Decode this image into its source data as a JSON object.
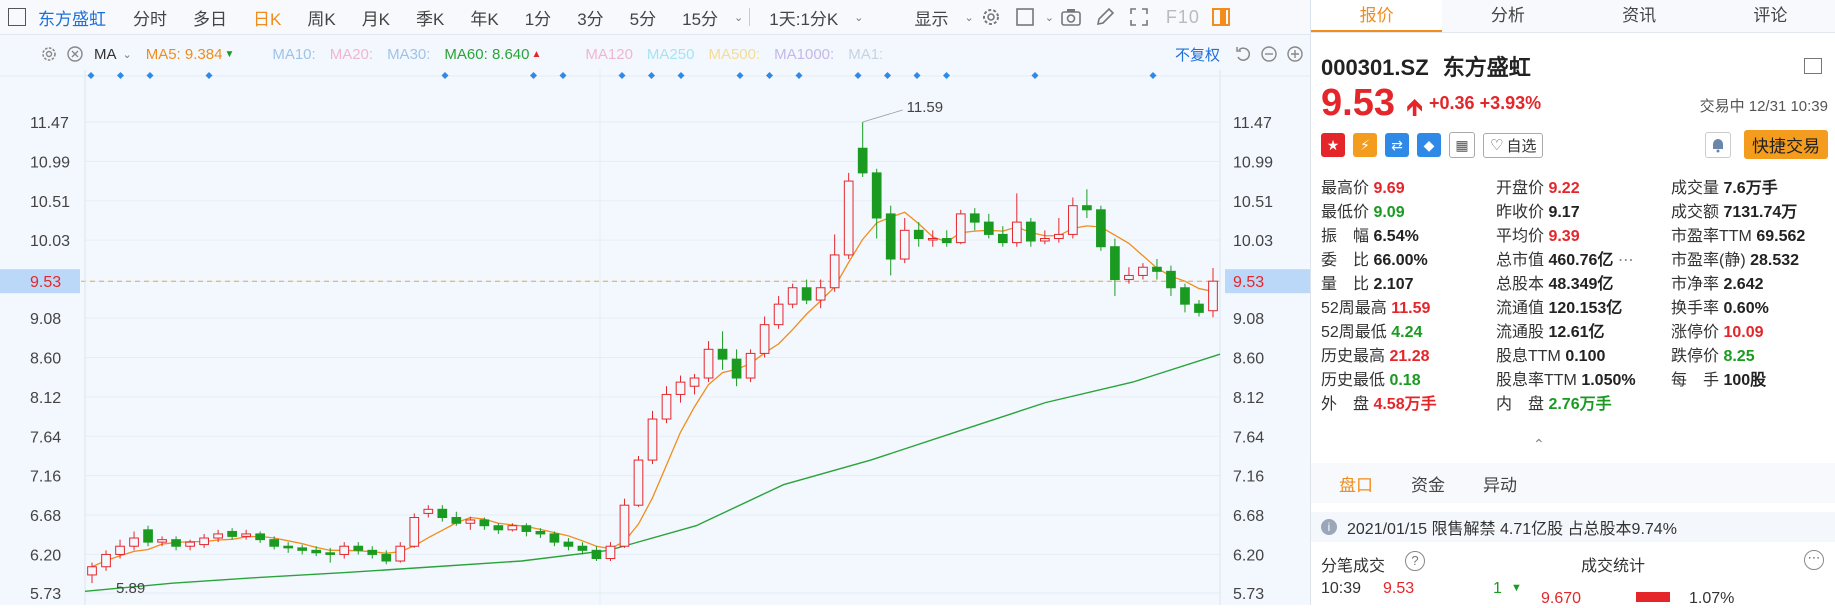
{
  "toolbar": {
    "stock_name": "东方盛虹",
    "periods": [
      "分时",
      "多日",
      "日K",
      "周K",
      "月K",
      "季K",
      "年K",
      "1分",
      "3分",
      "5分",
      "15分"
    ],
    "active_period": "日K",
    "interval_select": "1天:1分K",
    "display_label": "显示",
    "f10_label": "F10"
  },
  "ma_bar": {
    "ma_label": "MA",
    "ma5": "MA5: 9.384",
    "ma10": "MA10:",
    "ma20": "MA20:",
    "ma30": "MA30:",
    "ma60": "MA60: 8.640",
    "ma120": "MA120",
    "ma250": "MA250",
    "ma500": "MA500:",
    "ma1000": "MA1000:",
    "ma1": "MA1:",
    "adjust": "不复权"
  },
  "chart_data": {
    "type": "candlestick",
    "yticks": [
      "11.47",
      "10.99",
      "10.51",
      "10.03",
      "9.53",
      "9.08",
      "8.60",
      "8.12",
      "7.64",
      "7.16",
      "6.68",
      "6.20",
      "5.73"
    ],
    "ylim": [
      5.73,
      11.47
    ],
    "high_marker": "11.59",
    "low_marker": "5.89",
    "current_price_tag": "9.53",
    "series": [
      {
        "name": "MA5",
        "color": "#f08d1c"
      },
      {
        "name": "MA60",
        "color": "#2aa33a"
      }
    ],
    "candles": [
      [
        5.95,
        6.05,
        5.85,
        6.1
      ],
      [
        6.05,
        6.2,
        6.0,
        6.25
      ],
      [
        6.2,
        6.3,
        6.15,
        6.38
      ],
      [
        6.3,
        6.4,
        6.25,
        6.48
      ],
      [
        6.5,
        6.35,
        6.3,
        6.55
      ],
      [
        6.35,
        6.38,
        6.3,
        6.42
      ],
      [
        6.38,
        6.3,
        6.25,
        6.42
      ],
      [
        6.3,
        6.35,
        6.25,
        6.38
      ],
      [
        6.32,
        6.4,
        6.28,
        6.45
      ],
      [
        6.4,
        6.45,
        6.35,
        6.5
      ],
      [
        6.48,
        6.42,
        6.38,
        6.52
      ],
      [
        6.42,
        6.45,
        6.38,
        6.5
      ],
      [
        6.45,
        6.38,
        6.34,
        6.48
      ],
      [
        6.38,
        6.3,
        6.26,
        6.42
      ],
      [
        6.3,
        6.28,
        6.22,
        6.35
      ],
      [
        6.28,
        6.25,
        6.2,
        6.32
      ],
      [
        6.25,
        6.22,
        6.18,
        6.3
      ],
      [
        6.22,
        6.2,
        6.1,
        6.28
      ],
      [
        6.2,
        6.3,
        6.15,
        6.35
      ],
      [
        6.3,
        6.25,
        6.2,
        6.35
      ],
      [
        6.25,
        6.2,
        6.15,
        6.3
      ],
      [
        6.2,
        6.12,
        6.08,
        6.25
      ],
      [
        6.12,
        6.3,
        6.1,
        6.35
      ],
      [
        6.3,
        6.65,
        6.28,
        6.7
      ],
      [
        6.7,
        6.75,
        6.65,
        6.8
      ],
      [
        6.75,
        6.65,
        6.6,
        6.8
      ],
      [
        6.65,
        6.58,
        6.55,
        6.72
      ],
      [
        6.58,
        6.62,
        6.5,
        6.66
      ],
      [
        6.62,
        6.55,
        6.5,
        6.65
      ],
      [
        6.55,
        6.5,
        6.45,
        6.58
      ],
      [
        6.5,
        6.55,
        6.48,
        6.58
      ],
      [
        6.55,
        6.48,
        6.42,
        6.58
      ],
      [
        6.48,
        6.45,
        6.4,
        6.52
      ],
      [
        6.45,
        6.35,
        6.3,
        6.48
      ],
      [
        6.35,
        6.3,
        6.25,
        6.4
      ],
      [
        6.3,
        6.25,
        6.2,
        6.35
      ],
      [
        6.25,
        6.15,
        6.12,
        6.3
      ],
      [
        6.15,
        6.3,
        6.12,
        6.35
      ],
      [
        6.3,
        6.8,
        6.28,
        6.88
      ],
      [
        6.8,
        7.35,
        6.78,
        7.4
      ],
      [
        7.35,
        7.85,
        7.3,
        7.95
      ],
      [
        7.85,
        8.15,
        7.8,
        8.25
      ],
      [
        8.15,
        8.3,
        8.05,
        8.38
      ],
      [
        8.25,
        8.35,
        8.15,
        8.4
      ],
      [
        8.35,
        8.7,
        8.3,
        8.8
      ],
      [
        8.7,
        8.58,
        8.45,
        8.92
      ],
      [
        8.58,
        8.35,
        8.25,
        8.7
      ],
      [
        8.35,
        8.65,
        8.3,
        8.7
      ],
      [
        8.65,
        9.0,
        8.6,
        9.1
      ],
      [
        9.0,
        9.25,
        8.95,
        9.35
      ],
      [
        9.25,
        9.45,
        9.2,
        9.5
      ],
      [
        9.45,
        9.3,
        9.25,
        9.55
      ],
      [
        9.3,
        9.45,
        9.2,
        9.55
      ],
      [
        9.45,
        9.85,
        9.4,
        10.1
      ],
      [
        9.85,
        10.75,
        9.8,
        10.85
      ],
      [
        11.15,
        10.85,
        10.8,
        11.47
      ],
      [
        10.85,
        10.3,
        10.05,
        10.9
      ],
      [
        10.35,
        9.8,
        9.6,
        10.45
      ],
      [
        9.8,
        10.15,
        9.75,
        10.3
      ],
      [
        10.15,
        10.05,
        9.95,
        10.25
      ],
      [
        10.05,
        10.05,
        9.95,
        10.15
      ],
      [
        10.05,
        10.0,
        9.95,
        10.15
      ],
      [
        10.0,
        10.35,
        9.98,
        10.4
      ],
      [
        10.35,
        10.25,
        10.15,
        10.42
      ],
      [
        10.25,
        10.1,
        10.05,
        10.35
      ],
      [
        10.1,
        10.0,
        9.95,
        10.2
      ],
      [
        10.0,
        10.25,
        9.95,
        10.6
      ],
      [
        10.25,
        10.02,
        9.95,
        10.3
      ],
      [
        10.02,
        10.05,
        9.98,
        10.15
      ],
      [
        10.05,
        10.1,
        10.0,
        10.3
      ],
      [
        10.1,
        10.45,
        10.05,
        10.55
      ],
      [
        10.45,
        10.4,
        10.3,
        10.65
      ],
      [
        10.4,
        9.95,
        9.9,
        10.45
      ],
      [
        9.95,
        9.55,
        9.35,
        10.05
      ],
      [
        9.55,
        9.6,
        9.5,
        9.7
      ],
      [
        9.6,
        9.7,
        9.55,
        9.75
      ],
      [
        9.7,
        9.65,
        9.55,
        9.8
      ],
      [
        9.65,
        9.45,
        9.35,
        9.72
      ],
      [
        9.45,
        9.25,
        9.15,
        9.5
      ],
      [
        9.25,
        9.15,
        9.1,
        9.3
      ],
      [
        9.17,
        9.53,
        9.09,
        9.69
      ]
    ],
    "ma60_curve": [
      [
        0,
        5.75
      ],
      [
        10,
        5.85
      ],
      [
        20,
        5.92
      ],
      [
        30,
        5.98
      ],
      [
        40,
        6.05
      ],
      [
        50,
        6.12
      ],
      [
        60,
        6.25
      ],
      [
        70,
        6.55
      ],
      [
        80,
        7.05
      ],
      [
        90,
        7.35
      ],
      [
        100,
        7.7
      ],
      [
        110,
        8.05
      ],
      [
        120,
        8.3
      ],
      [
        130,
        8.64
      ]
    ],
    "events": [
      0,
      1,
      2,
      4,
      12,
      15,
      16,
      18,
      19,
      20,
      22,
      23,
      24,
      26,
      27,
      28,
      29,
      32,
      36
    ]
  },
  "quote": {
    "code": "000301.SZ",
    "name": "东方盛虹",
    "price": "9.53",
    "change": "+0.36",
    "change_pct": "+3.93%",
    "status": "交易中 12/31 10:39",
    "add_watch": "自选",
    "quick_trade": "快捷交易",
    "rows": [
      [
        {
          "l": "最高价",
          "v": "9.69",
          "c": "red"
        },
        {
          "l": "开盘价",
          "v": "9.22",
          "c": "red"
        },
        {
          "l": "成交量",
          "v": "7.6万手",
          "c": "blk"
        }
      ],
      [
        {
          "l": "最低价",
          "v": "9.09",
          "c": "green"
        },
        {
          "l": "昨收价",
          "v": "9.17",
          "c": "blk"
        },
        {
          "l": "成交额",
          "v": "7131.74万",
          "c": "blk"
        }
      ],
      [
        {
          "l": "振　幅",
          "v": "6.54%",
          "c": "blk"
        },
        {
          "l": "平均价",
          "v": "9.39",
          "c": "red"
        },
        {
          "l": "市盈率TTM",
          "v": "69.562",
          "c": "blk"
        }
      ],
      [
        {
          "l": "委　比",
          "v": "66.00%",
          "c": "blk"
        },
        {
          "l": "总市值",
          "v": "460.76亿",
          "c": "blk"
        },
        {
          "l": "市盈率(静)",
          "v": "28.532",
          "c": "blk"
        }
      ],
      [
        {
          "l": "量　比",
          "v": "2.107",
          "c": "blk"
        },
        {
          "l": "总股本",
          "v": "48.349亿",
          "c": "blk"
        },
        {
          "l": "市净率",
          "v": "2.642",
          "c": "blk"
        }
      ],
      [
        {
          "l": "52周最高",
          "v": "11.59",
          "c": "red"
        },
        {
          "l": "流通值",
          "v": "120.153亿",
          "c": "blk"
        },
        {
          "l": "换手率",
          "v": "0.60%",
          "c": "blk"
        }
      ],
      [
        {
          "l": "52周最低",
          "v": "4.24",
          "c": "green"
        },
        {
          "l": "流通股",
          "v": "12.61亿",
          "c": "blk"
        },
        {
          "l": "涨停价",
          "v": "10.09",
          "c": "red"
        }
      ],
      [
        {
          "l": "历史最高",
          "v": "21.28",
          "c": "red"
        },
        {
          "l": "股息TTM",
          "v": "0.100",
          "c": "blk"
        },
        {
          "l": "跌停价",
          "v": "8.25",
          "c": "green"
        }
      ],
      [
        {
          "l": "历史最低",
          "v": "0.18",
          "c": "green"
        },
        {
          "l": "股息率TTM",
          "v": "1.050%",
          "c": "blk"
        },
        {
          "l": "每　手",
          "v": "100股",
          "c": "blk"
        }
      ],
      [
        {
          "l": "外　盘",
          "v": "4.58万手",
          "c": "red"
        },
        {
          "l": "内　盘",
          "v": "2.76万手",
          "c": "green"
        },
        {
          "l": "",
          "v": "",
          "c": "blk"
        }
      ]
    ]
  },
  "right_tabs": [
    "报价",
    "分析",
    "资讯",
    "评论"
  ],
  "lower_tabs": [
    "盘口",
    "资金",
    "异动"
  ],
  "notice": "2021/01/15  限售解禁 4.71亿股 占总股本9.74%",
  "tick_title": "分笔成交",
  "deal_stats_title": "成交统计",
  "tick_row": {
    "time": "10:39",
    "price": "9.53",
    "vol": "1"
  },
  "deal_stats_price": "9.670",
  "deal_stats_pct": "1.07%",
  "colors": {
    "up": "#e4262b",
    "down": "#1a9a21",
    "ma5": "#f08d1c",
    "ma60": "#2aa33a",
    "accent": "#f08d1c"
  }
}
